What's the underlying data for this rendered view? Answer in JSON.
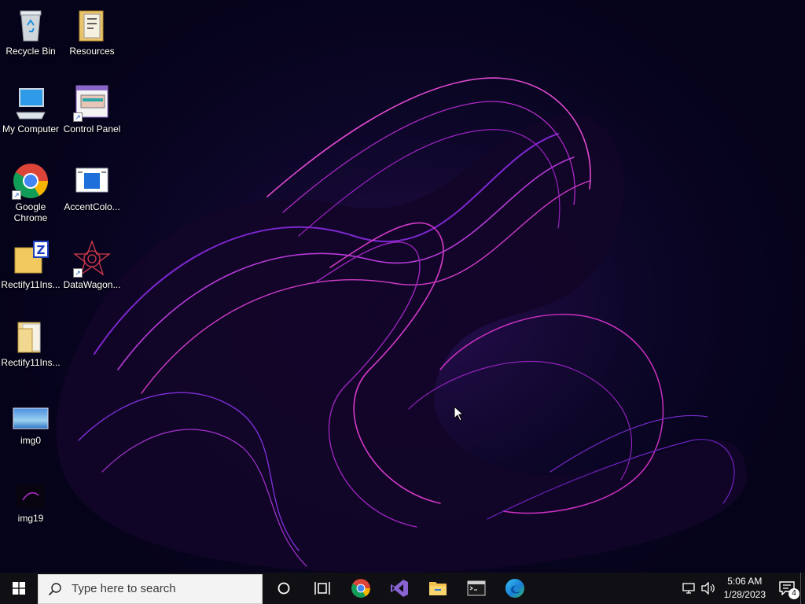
{
  "desktop": {
    "icons": [
      {
        "label": "Recycle Bin",
        "icon": "recycle-bin-icon"
      },
      {
        "label": "Resources",
        "icon": "folder-icon"
      },
      {
        "label": "My Computer",
        "icon": "computer-icon"
      },
      {
        "label": "Control Panel",
        "icon": "control-panel-icon"
      },
      {
        "label": "Google Chrome",
        "icon": "chrome-icon"
      },
      {
        "label": "AccentColo...",
        "icon": "app-window-icon"
      },
      {
        "label": "Rectify11Ins...",
        "icon": "zip-folder-icon"
      },
      {
        "label": "DataWagon...",
        "icon": "datawagon-icon"
      },
      {
        "label": "Rectify11Ins...",
        "icon": "folder-icon"
      },
      {
        "label": "img0",
        "icon": "image-icon"
      },
      {
        "label": "img19",
        "icon": "image-icon"
      }
    ]
  },
  "taskbar": {
    "search_placeholder": "Type here to search",
    "pinned": [
      "cortana-icon",
      "task-view-icon",
      "chrome-icon",
      "visual-studio-icon",
      "file-explorer-icon",
      "terminal-icon",
      "edge-icon"
    ],
    "clock": {
      "time": "5:06 AM",
      "date": "1/28/2023"
    },
    "notification_count": "4"
  },
  "colors": {
    "taskbar_bg": "#101014",
    "wallpaper_accent": "#c12bd6",
    "wallpaper_bg": "#05031a"
  }
}
